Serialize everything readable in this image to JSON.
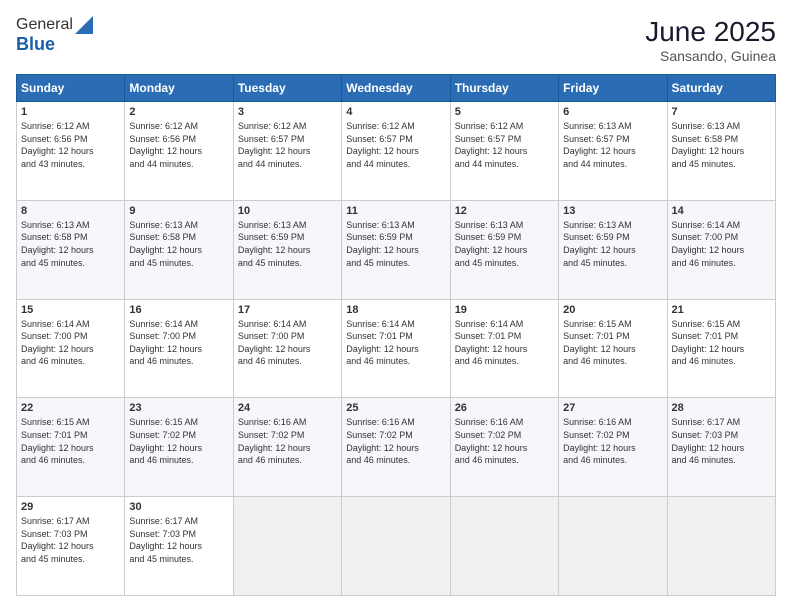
{
  "header": {
    "logo_general": "General",
    "logo_blue": "Blue",
    "month_title": "June 2025",
    "location": "Sansando, Guinea"
  },
  "columns": [
    "Sunday",
    "Monday",
    "Tuesday",
    "Wednesday",
    "Thursday",
    "Friday",
    "Saturday"
  ],
  "weeks": [
    [
      {
        "day": "1",
        "lines": [
          "Sunrise: 6:12 AM",
          "Sunset: 6:56 PM",
          "Daylight: 12 hours",
          "and 43 minutes."
        ]
      },
      {
        "day": "2",
        "lines": [
          "Sunrise: 6:12 AM",
          "Sunset: 6:56 PM",
          "Daylight: 12 hours",
          "and 44 minutes."
        ]
      },
      {
        "day": "3",
        "lines": [
          "Sunrise: 6:12 AM",
          "Sunset: 6:57 PM",
          "Daylight: 12 hours",
          "and 44 minutes."
        ]
      },
      {
        "day": "4",
        "lines": [
          "Sunrise: 6:12 AM",
          "Sunset: 6:57 PM",
          "Daylight: 12 hours",
          "and 44 minutes."
        ]
      },
      {
        "day": "5",
        "lines": [
          "Sunrise: 6:12 AM",
          "Sunset: 6:57 PM",
          "Daylight: 12 hours",
          "and 44 minutes."
        ]
      },
      {
        "day": "6",
        "lines": [
          "Sunrise: 6:13 AM",
          "Sunset: 6:57 PM",
          "Daylight: 12 hours",
          "and 44 minutes."
        ]
      },
      {
        "day": "7",
        "lines": [
          "Sunrise: 6:13 AM",
          "Sunset: 6:58 PM",
          "Daylight: 12 hours",
          "and 45 minutes."
        ]
      }
    ],
    [
      {
        "day": "8",
        "lines": [
          "Sunrise: 6:13 AM",
          "Sunset: 6:58 PM",
          "Daylight: 12 hours",
          "and 45 minutes."
        ]
      },
      {
        "day": "9",
        "lines": [
          "Sunrise: 6:13 AM",
          "Sunset: 6:58 PM",
          "Daylight: 12 hours",
          "and 45 minutes."
        ]
      },
      {
        "day": "10",
        "lines": [
          "Sunrise: 6:13 AM",
          "Sunset: 6:59 PM",
          "Daylight: 12 hours",
          "and 45 minutes."
        ]
      },
      {
        "day": "11",
        "lines": [
          "Sunrise: 6:13 AM",
          "Sunset: 6:59 PM",
          "Daylight: 12 hours",
          "and 45 minutes."
        ]
      },
      {
        "day": "12",
        "lines": [
          "Sunrise: 6:13 AM",
          "Sunset: 6:59 PM",
          "Daylight: 12 hours",
          "and 45 minutes."
        ]
      },
      {
        "day": "13",
        "lines": [
          "Sunrise: 6:13 AM",
          "Sunset: 6:59 PM",
          "Daylight: 12 hours",
          "and 45 minutes."
        ]
      },
      {
        "day": "14",
        "lines": [
          "Sunrise: 6:14 AM",
          "Sunset: 7:00 PM",
          "Daylight: 12 hours",
          "and 46 minutes."
        ]
      }
    ],
    [
      {
        "day": "15",
        "lines": [
          "Sunrise: 6:14 AM",
          "Sunset: 7:00 PM",
          "Daylight: 12 hours",
          "and 46 minutes."
        ]
      },
      {
        "day": "16",
        "lines": [
          "Sunrise: 6:14 AM",
          "Sunset: 7:00 PM",
          "Daylight: 12 hours",
          "and 46 minutes."
        ]
      },
      {
        "day": "17",
        "lines": [
          "Sunrise: 6:14 AM",
          "Sunset: 7:00 PM",
          "Daylight: 12 hours",
          "and 46 minutes."
        ]
      },
      {
        "day": "18",
        "lines": [
          "Sunrise: 6:14 AM",
          "Sunset: 7:01 PM",
          "Daylight: 12 hours",
          "and 46 minutes."
        ]
      },
      {
        "day": "19",
        "lines": [
          "Sunrise: 6:14 AM",
          "Sunset: 7:01 PM",
          "Daylight: 12 hours",
          "and 46 minutes."
        ]
      },
      {
        "day": "20",
        "lines": [
          "Sunrise: 6:15 AM",
          "Sunset: 7:01 PM",
          "Daylight: 12 hours",
          "and 46 minutes."
        ]
      },
      {
        "day": "21",
        "lines": [
          "Sunrise: 6:15 AM",
          "Sunset: 7:01 PM",
          "Daylight: 12 hours",
          "and 46 minutes."
        ]
      }
    ],
    [
      {
        "day": "22",
        "lines": [
          "Sunrise: 6:15 AM",
          "Sunset: 7:01 PM",
          "Daylight: 12 hours",
          "and 46 minutes."
        ]
      },
      {
        "day": "23",
        "lines": [
          "Sunrise: 6:15 AM",
          "Sunset: 7:02 PM",
          "Daylight: 12 hours",
          "and 46 minutes."
        ]
      },
      {
        "day": "24",
        "lines": [
          "Sunrise: 6:16 AM",
          "Sunset: 7:02 PM",
          "Daylight: 12 hours",
          "and 46 minutes."
        ]
      },
      {
        "day": "25",
        "lines": [
          "Sunrise: 6:16 AM",
          "Sunset: 7:02 PM",
          "Daylight: 12 hours",
          "and 46 minutes."
        ]
      },
      {
        "day": "26",
        "lines": [
          "Sunrise: 6:16 AM",
          "Sunset: 7:02 PM",
          "Daylight: 12 hours",
          "and 46 minutes."
        ]
      },
      {
        "day": "27",
        "lines": [
          "Sunrise: 6:16 AM",
          "Sunset: 7:02 PM",
          "Daylight: 12 hours",
          "and 46 minutes."
        ]
      },
      {
        "day": "28",
        "lines": [
          "Sunrise: 6:17 AM",
          "Sunset: 7:03 PM",
          "Daylight: 12 hours",
          "and 46 minutes."
        ]
      }
    ],
    [
      {
        "day": "29",
        "lines": [
          "Sunrise: 6:17 AM",
          "Sunset: 7:03 PM",
          "Daylight: 12 hours",
          "and 45 minutes."
        ]
      },
      {
        "day": "30",
        "lines": [
          "Sunrise: 6:17 AM",
          "Sunset: 7:03 PM",
          "Daylight: 12 hours",
          "and 45 minutes."
        ]
      },
      {
        "day": "",
        "lines": []
      },
      {
        "day": "",
        "lines": []
      },
      {
        "day": "",
        "lines": []
      },
      {
        "day": "",
        "lines": []
      },
      {
        "day": "",
        "lines": []
      }
    ]
  ]
}
